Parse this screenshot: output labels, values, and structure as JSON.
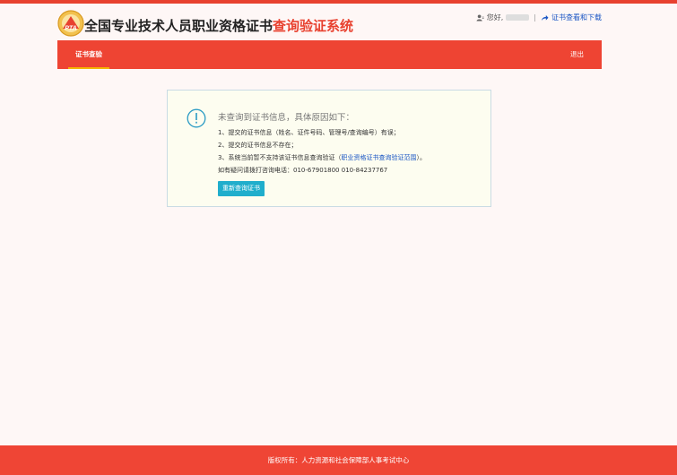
{
  "header": {
    "logo_text": "PTA",
    "title_main": "全国专业技术人员职业资格证书",
    "title_accent": "查询验证系统",
    "greeting": "您好,",
    "separator": "|",
    "cert_link": "证书查看和下载"
  },
  "nav": {
    "tab_label": "证书查验",
    "logout_label": "退出"
  },
  "notice": {
    "title": "未查询到证书信息，具体原因如下：",
    "reason_1": "1、提交的证书信息（姓名、证件号码、管理号/查询编号）有误；",
    "reason_2": "2、提交的证书信息不存在；",
    "reason_3_prefix": "3、系统当前暂不支持该证书信息查询验证（",
    "reason_3_link": "职业资格证书查询验证范围",
    "reason_3_suffix": "）。",
    "hotline": "如有疑问请拨打咨询电话：010-67901800 010-84237767",
    "requery_label": "重新查询证书"
  },
  "footer": {
    "text": "版权所有：人力资源和社会保障部人事考试中心"
  },
  "colors": {
    "brand_red": "#ee4433",
    "nav_underline": "#f5b400",
    "button_blue": "#20aecc",
    "link_blue": "#1a56c4",
    "notice_bg": "#fdfdf0"
  }
}
